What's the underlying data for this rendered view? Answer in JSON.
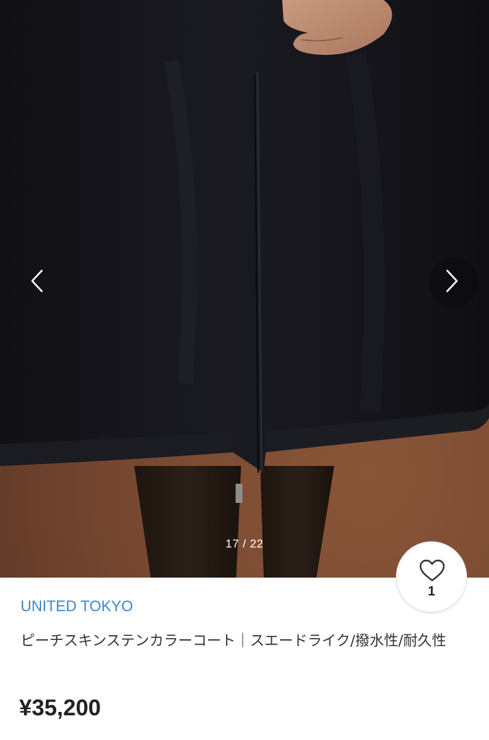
{
  "gallery": {
    "counter": "17 / 22",
    "prev_icon": "chevron-left-icon",
    "next_icon": "chevron-right-icon"
  },
  "like": {
    "icon": "heart-outline-icon",
    "count": "1"
  },
  "product": {
    "brand": "UNITED TOKYO",
    "title": "ピーチスキンステンカラーコート｜スエードライク/撥水性/耐久性",
    "price": "¥35,200"
  },
  "colors": {
    "brand_link": "#3d86c6",
    "backdrop": "#7a4a31",
    "coat": "#16161c"
  }
}
